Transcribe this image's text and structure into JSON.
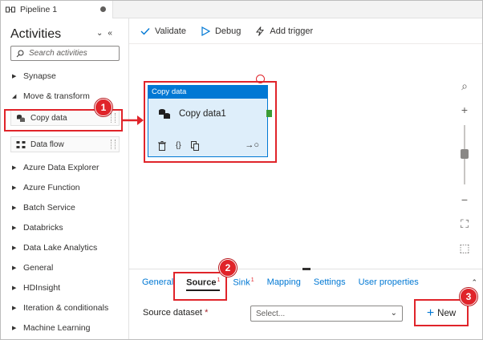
{
  "tab": {
    "title": "Pipeline 1"
  },
  "sidebar": {
    "title": "Activities",
    "search_placeholder": "Search activities",
    "categories_top": [
      {
        "label": "Synapse",
        "expanded": false
      },
      {
        "label": "Move & transform",
        "expanded": true
      }
    ],
    "activities": [
      {
        "label": "Copy data"
      },
      {
        "label": "Data flow"
      }
    ],
    "categories": [
      {
        "label": "Azure Data Explorer"
      },
      {
        "label": "Azure Function"
      },
      {
        "label": "Batch Service"
      },
      {
        "label": "Databricks"
      },
      {
        "label": "Data Lake Analytics"
      },
      {
        "label": "General"
      },
      {
        "label": "HDInsight"
      },
      {
        "label": "Iteration & conditionals"
      },
      {
        "label": "Machine Learning"
      }
    ]
  },
  "toolbar": {
    "validate": "Validate",
    "debug": "Debug",
    "add_trigger": "Add trigger"
  },
  "node": {
    "header": "Copy data",
    "name": "Copy data1",
    "code_glyph": "{}"
  },
  "panel": {
    "tabs": [
      {
        "label": "General",
        "badge": ""
      },
      {
        "label": "Source",
        "badge": "1"
      },
      {
        "label": "Sink",
        "badge": "1"
      },
      {
        "label": "Mapping",
        "badge": ""
      },
      {
        "label": "Settings",
        "badge": ""
      },
      {
        "label": "User properties",
        "badge": ""
      }
    ],
    "active_tab": "Source",
    "source_dataset_label": "Source dataset",
    "required_mark": "*",
    "select_value": "Select...",
    "new_label": "New"
  },
  "callouts": [
    "1",
    "2",
    "3"
  ],
  "colors": {
    "accent": "#0078d4",
    "callout": "#e0242a",
    "port": "#3c9c35"
  }
}
